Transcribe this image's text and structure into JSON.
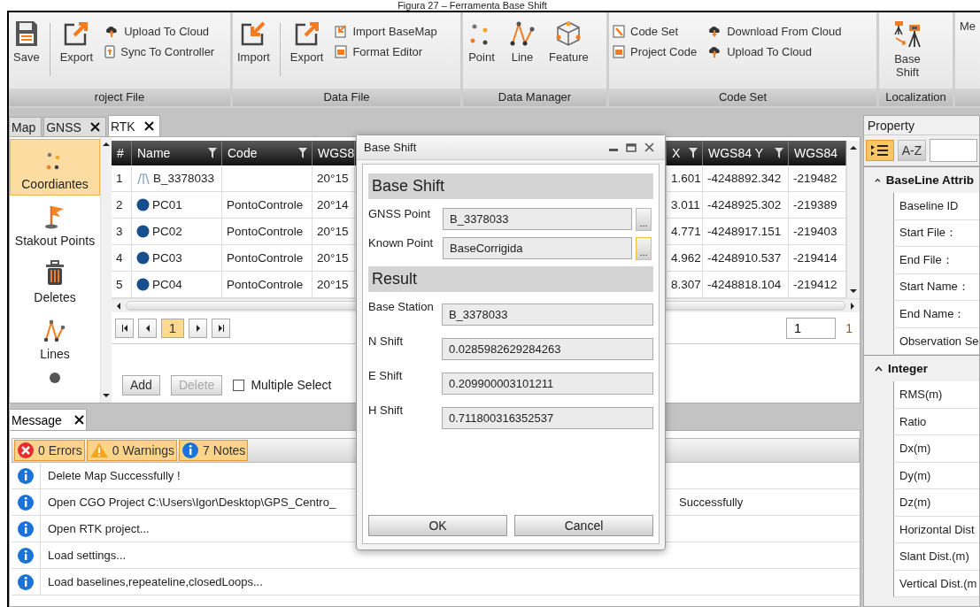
{
  "caption": "Figura 27 – Ferramenta Base Shift",
  "ribbon": {
    "groups": [
      {
        "label": "roject File",
        "items": [
          {
            "kind": "large",
            "label": "Save"
          },
          {
            "kind": "separator"
          },
          {
            "kind": "large",
            "label": "Export"
          },
          {
            "kind": "stack",
            "entries": [
              "Upload To Cloud",
              "Sync To Controller"
            ]
          }
        ]
      },
      {
        "label": "Data File",
        "items": [
          {
            "kind": "large",
            "label": "Import"
          },
          {
            "kind": "separator"
          },
          {
            "kind": "large",
            "label": "Export"
          },
          {
            "kind": "stack",
            "entries": [
              "Import BaseMap",
              "Format Editor"
            ]
          }
        ]
      },
      {
        "label": "Data Manager",
        "items": [
          {
            "kind": "large",
            "label": "Point"
          },
          {
            "kind": "large",
            "label": "Line"
          },
          {
            "kind": "large",
            "label": "Feature"
          }
        ]
      },
      {
        "label": "Code Set",
        "items": [
          {
            "kind": "stack",
            "entries": [
              "Code Set",
              "Project Code"
            ]
          },
          {
            "kind": "stack",
            "entries": [
              "Download From Cloud",
              "Upload To Cloud"
            ]
          }
        ]
      },
      {
        "label": "Localization",
        "items": [
          {
            "kind": "large",
            "label": "Base Shift"
          }
        ]
      },
      {
        "items": [
          {
            "kind": "large",
            "label": "Me"
          }
        ]
      }
    ]
  },
  "tabs": [
    {
      "label": "Map",
      "closable": false,
      "selected": false
    },
    {
      "label": "GNSS",
      "closable": true,
      "selected": false
    },
    {
      "label": "RTK",
      "closable": true,
      "selected": true
    }
  ],
  "sidebar": {
    "items": [
      {
        "label": "Coordiantes",
        "selected": true
      },
      {
        "label": "Stakout Points",
        "selected": false
      },
      {
        "label": "Deletes",
        "selected": false
      },
      {
        "label": "Lines",
        "selected": false
      }
    ]
  },
  "table": {
    "columns": [
      {
        "label": "#",
        "filter": false
      },
      {
        "label": "Name",
        "filter": true
      },
      {
        "label": "Code",
        "filter": true
      },
      {
        "label": "WGS8"
      },
      {
        "label": "X",
        "filter": true
      },
      {
        "label": "WGS84 Y",
        "filter": true
      },
      {
        "label": "WGS84",
        "filter": false
      }
    ],
    "rows": [
      {
        "kind": "base",
        "cells": [
          "1",
          "B_3378033",
          "",
          "20°15",
          "1.601",
          "-4248892.342",
          "-219482"
        ]
      },
      {
        "kind": "point",
        "cells": [
          "2",
          "PC01",
          "PontoControle",
          "20°14",
          "3.011",
          "-4248925.302",
          "-219389"
        ]
      },
      {
        "kind": "point",
        "cells": [
          "3",
          "PC02",
          "PontoControle",
          "20°15",
          "4.771",
          "-4248917.151",
          "-219403"
        ]
      },
      {
        "kind": "point",
        "cells": [
          "4",
          "PC03",
          "PontoControle",
          "20°15",
          "4.962",
          "-4248910.537",
          "-219414"
        ]
      },
      {
        "kind": "point",
        "cells": [
          "5",
          "PC04",
          "PontoControle",
          "20°15",
          "8.307",
          "-4248818.104",
          "-219412"
        ]
      }
    ]
  },
  "pager": {
    "page": "1",
    "page_selected": true,
    "page_input": "1",
    "page_count": "1"
  },
  "actions": {
    "buttons": [
      {
        "label": "Add",
        "disabled": false
      },
      {
        "label": "Delete",
        "disabled": true
      }
    ],
    "checkbox": {
      "label": "Multiple Select",
      "checked": false
    }
  },
  "messages": {
    "tab": "Message",
    "filters": [
      {
        "kind": "error",
        "label": "0 Errors"
      },
      {
        "kind": "warning",
        "label": "0 Warnings"
      },
      {
        "kind": "note",
        "label": "7 Notes"
      }
    ],
    "rows": [
      {
        "text": "Delete Map Successfully !"
      },
      {
        "text": "Open CGO Project C:\\Users\\Igor\\Desktop\\GPS_Centro_",
        "text_after": "Successfully"
      },
      {
        "text": "Open RTK project..."
      },
      {
        "text": "Load settings..."
      },
      {
        "text": "Load baselines,repeateline,closedLoops..."
      }
    ]
  },
  "dialog": {
    "title": "Base Shift",
    "sections": [
      {
        "heading": "Base Shift",
        "fields": [
          {
            "label": "GNSS Point",
            "value": "B_3378033",
            "browse": "...",
            "focused": false
          },
          {
            "label": "Known Point",
            "value": "BaseCorrigida",
            "browse": "...",
            "focused": true
          }
        ]
      },
      {
        "heading": "Result",
        "fields": [
          {
            "label": "Base Station",
            "value": "B_3378033"
          },
          {
            "label": "N Shift",
            "value": "0.0285982629284263"
          },
          {
            "label": "E Shift",
            "value": "0.209900003101211"
          },
          {
            "label": "H Shift",
            "value": "0.711800316352537"
          }
        ]
      }
    ],
    "buttons": [
      "OK",
      "Cancel"
    ]
  },
  "property": {
    "title": "Property",
    "view_buttons": [
      {
        "kind": "categorized",
        "selected": true
      },
      {
        "kind": "alphabetical",
        "label": "A-Z",
        "selected": false
      }
    ],
    "groups": [
      {
        "label": "BaseLine Attrib",
        "expanded": true,
        "rows": [
          "Baseline ID",
          "Start File：",
          "End File：",
          "Start Name：",
          "End Name：",
          "Observation Se"
        ]
      },
      {
        "label": "Integer",
        "expanded": true,
        "rows": [
          "RMS(m)",
          "Ratio",
          "Dx(m)",
          "Dy(m)",
          "Dz(m)",
          "Horizontal Dist",
          "Slant Dist.(m)",
          "Vertical Dist.(m"
        ]
      }
    ]
  }
}
